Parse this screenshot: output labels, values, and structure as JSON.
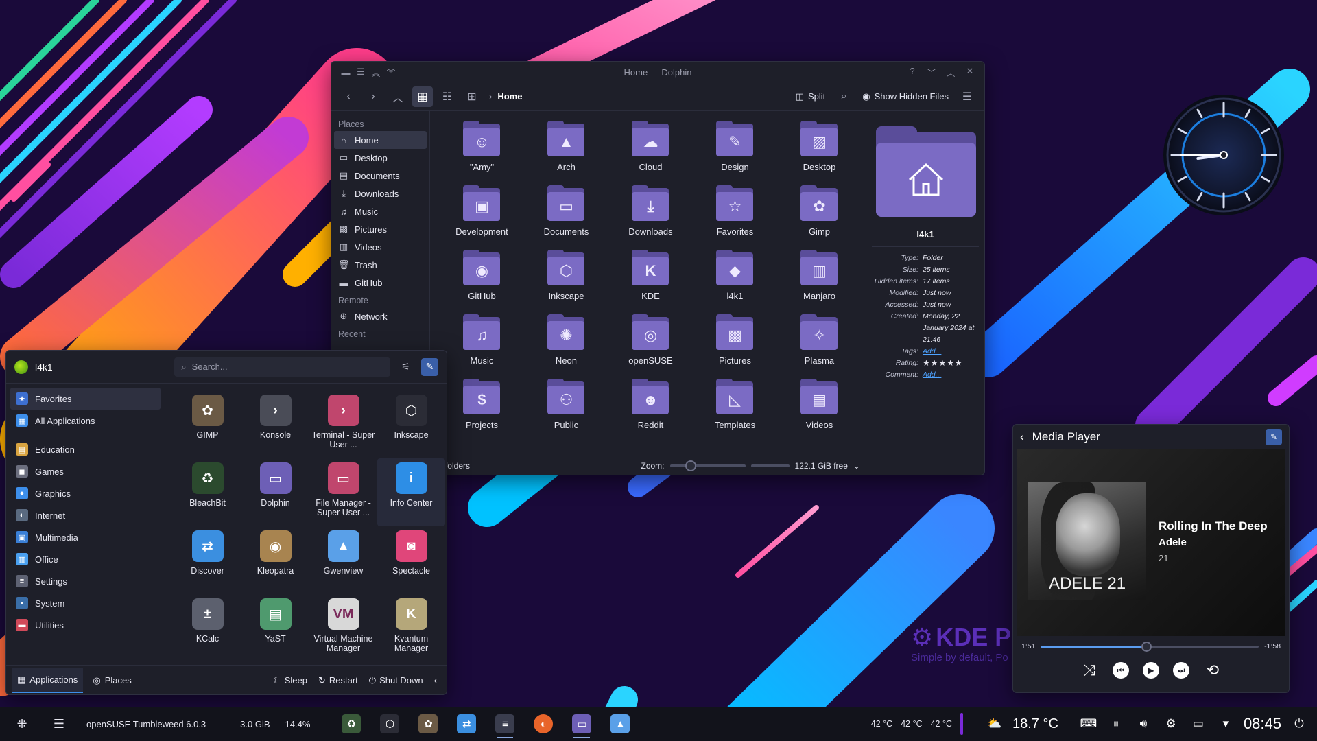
{
  "dolphin": {
    "title": "Home — Dolphin",
    "breadcrumb": "Home",
    "split_label": "Split",
    "hidden_files_label": "Show Hidden Files",
    "places_heading": "Places",
    "places": [
      {
        "label": "Home",
        "icon": "home-icon"
      },
      {
        "label": "Desktop",
        "icon": "desktop-icon"
      },
      {
        "label": "Documents",
        "icon": "documents-icon"
      },
      {
        "label": "Downloads",
        "icon": "downloads-icon"
      },
      {
        "label": "Music",
        "icon": "music-icon"
      },
      {
        "label": "Pictures",
        "icon": "pictures-icon"
      },
      {
        "label": "Videos",
        "icon": "videos-icon"
      },
      {
        "label": "Trash",
        "icon": "trash-icon"
      },
      {
        "label": "GitHub",
        "icon": "github-icon"
      }
    ],
    "remote_heading": "Remote",
    "network_label": "Network",
    "recent_heading": "Recent",
    "folders": [
      {
        "name": "\"Amy\"",
        "glyph": "☺"
      },
      {
        "name": "Arch",
        "glyph": "▲"
      },
      {
        "name": "Cloud",
        "glyph": "☁"
      },
      {
        "name": "Design",
        "glyph": "✎"
      },
      {
        "name": "Desktop",
        "glyph": "▨"
      },
      {
        "name": "Development",
        "glyph": "▣"
      },
      {
        "name": "Documents",
        "glyph": "▭"
      },
      {
        "name": "Downloads",
        "glyph": "⤓"
      },
      {
        "name": "Favorites",
        "glyph": "☆"
      },
      {
        "name": "Gimp",
        "glyph": "✿"
      },
      {
        "name": "GitHub",
        "glyph": "◉"
      },
      {
        "name": "Inkscape",
        "glyph": "⬡"
      },
      {
        "name": "KDE",
        "glyph": "K"
      },
      {
        "name": "l4k1",
        "glyph": "◆"
      },
      {
        "name": "Manjaro",
        "glyph": "▥"
      },
      {
        "name": "Music",
        "glyph": "♫"
      },
      {
        "name": "Neon",
        "glyph": "✺"
      },
      {
        "name": "openSUSE",
        "glyph": "◎"
      },
      {
        "name": "Pictures",
        "glyph": "▩"
      },
      {
        "name": "Plasma",
        "glyph": "✧"
      },
      {
        "name": "Projects",
        "glyph": "$"
      },
      {
        "name": "Public",
        "glyph": "⚇"
      },
      {
        "name": "Reddit",
        "glyph": "☻"
      },
      {
        "name": "Templates",
        "glyph": "◺"
      },
      {
        "name": "Videos",
        "glyph": "▤"
      }
    ],
    "status": {
      "folders_text": "folders",
      "zoom_label": "Zoom:",
      "free_space": "122.1 GiB free"
    },
    "info": {
      "name": "l4k1",
      "rows": [
        {
          "k": "Type:",
          "v": "Folder"
        },
        {
          "k": "Size:",
          "v": "25 items"
        },
        {
          "k": "Hidden items:",
          "v": "17 items"
        },
        {
          "k": "Modified:",
          "v": "Just now"
        },
        {
          "k": "Accessed:",
          "v": "Just now"
        },
        {
          "k": "Created:",
          "v": "Monday, 22 January 2024 at 21:46"
        }
      ],
      "tags_label": "Tags:",
      "tags_value": "Add...",
      "rating_label": "Rating:",
      "rating_value": "★★★★★",
      "comment_label": "Comment:",
      "comment_value": "Add..."
    }
  },
  "menu": {
    "user": "l4k1",
    "search_placeholder": "Search...",
    "categories_top": [
      {
        "label": "Favorites",
        "color": "#3d6fd1",
        "glyph": "★"
      },
      {
        "label": "All Applications",
        "color": "#3d8eea",
        "glyph": "▦"
      }
    ],
    "categories": [
      {
        "label": "Education",
        "color": "#d9a441",
        "glyph": "▤"
      },
      {
        "label": "Games",
        "color": "#6b6e7e",
        "glyph": "◼"
      },
      {
        "label": "Graphics",
        "color": "#3d8eea",
        "glyph": "●"
      },
      {
        "label": "Internet",
        "color": "#5a6a80",
        "glyph": "◐"
      },
      {
        "label": "Multimedia",
        "color": "#3a7fd6",
        "glyph": "▣"
      },
      {
        "label": "Office",
        "color": "#4aa0f0",
        "glyph": "▥"
      },
      {
        "label": "Settings",
        "color": "#5e6273",
        "glyph": "≡"
      },
      {
        "label": "System",
        "color": "#3a6ea8",
        "glyph": "▪"
      },
      {
        "label": "Utilities",
        "color": "#d04a5a",
        "glyph": "▬"
      }
    ],
    "apps": [
      {
        "name": "GIMP",
        "color": "#6b5a45",
        "glyph": "✿"
      },
      {
        "name": "Konsole",
        "color": "#4a4c57",
        "glyph": "›"
      },
      {
        "name": "Terminal - Super User ...",
        "color": "#c0466d",
        "glyph": "›"
      },
      {
        "name": "Inkscape",
        "color": "#2b2c36",
        "glyph": "⬡"
      },
      {
        "name": "BleachBit",
        "color": "#2b4a2e",
        "glyph": "♻"
      },
      {
        "name": "Dolphin",
        "color": "#6d5fb6",
        "glyph": "▭"
      },
      {
        "name": "File Manager - Super User ...",
        "color": "#c0466d",
        "glyph": "▭"
      },
      {
        "name": "Info Center",
        "color": "#2d8ee6",
        "glyph": "i"
      },
      {
        "name": "Discover",
        "color": "#3b8fe0",
        "glyph": "⇄"
      },
      {
        "name": "Kleopatra",
        "color": "#a88450",
        "glyph": "◉"
      },
      {
        "name": "Gwenview",
        "color": "#5aa0e8",
        "glyph": "▲"
      },
      {
        "name": "Spectacle",
        "color": "#e0467a",
        "glyph": "◙"
      },
      {
        "name": "KCalc",
        "color": "#5c606e",
        "glyph": "±"
      },
      {
        "name": "YaST",
        "color": "#4f9a6e",
        "glyph": "▤"
      },
      {
        "name": "Virtual Machine Manager",
        "color": "#d8d8d8",
        "glyph": "VM"
      },
      {
        "name": "Kvantum Manager",
        "color": "#b5a77a",
        "glyph": "K"
      }
    ],
    "footer": {
      "applications": "Applications",
      "places": "Places",
      "sleep": "Sleep",
      "restart": "Restart",
      "shutdown": "Shut Down"
    }
  },
  "media_player": {
    "title": "Media Player",
    "track": "Rolling In The Deep",
    "artist": "Adele",
    "album": "21",
    "cover_text": "ADELE 21",
    "elapsed": "1:51",
    "remaining": "-1:58",
    "progress_fraction": 0.485
  },
  "clock": {
    "hour": 8,
    "minute": 45
  },
  "watermark": {
    "title": "KDE Pl",
    "subtitle": "Simple by default, Po"
  },
  "panel": {
    "os_name": "openSUSE Tumbleweed 6.0.3",
    "memory": "3.0 GiB",
    "cpu": "14.4%",
    "temps": [
      "42 °C",
      "42 °C",
      "42 °C"
    ],
    "weather_temp": "18.7 °C",
    "time": "08:45"
  },
  "colors": {
    "accent": "#3d8eea",
    "folder": "#7b6bc4",
    "folder_back": "#5a4d9a",
    "window_bg": "#1e1f29"
  }
}
